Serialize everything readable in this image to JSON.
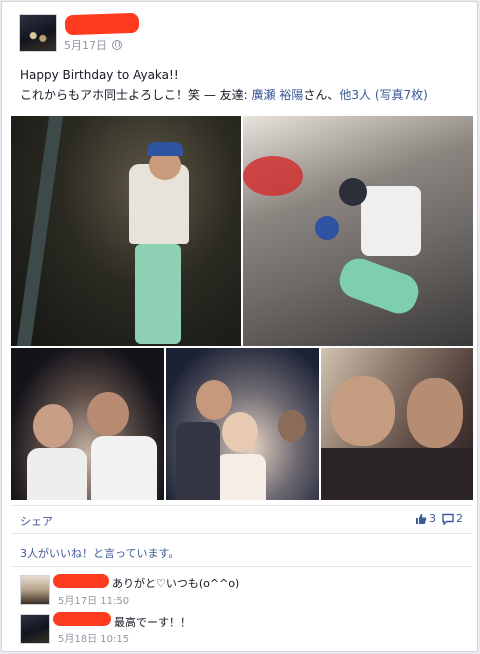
{
  "post": {
    "date": "5月17日",
    "line1": "Happy Birthday to Ayaka!!",
    "line2_prefix": "これからもアホ同士よろしこ！笑 — 友達: ",
    "tag_friend": "廣瀬 裕陽",
    "tag_sep1": "さん、",
    "tag_others": "他3人",
    "tag_sep2": " ",
    "photo_count": "(写真7枚)"
  },
  "actions": {
    "share_label": "シェア",
    "like_count": "3",
    "comment_count": "2"
  },
  "likes_summary": "3人がいいね！と言っています。",
  "comments": [
    {
      "text": "ありがと♡いつも(o^^o)",
      "time": "5月17日 11:50"
    },
    {
      "text": "最高でーす！！",
      "time": "5月18日 10:15"
    }
  ],
  "colors": {
    "link": "#3b5998",
    "redaction": "#ff3b1f"
  }
}
